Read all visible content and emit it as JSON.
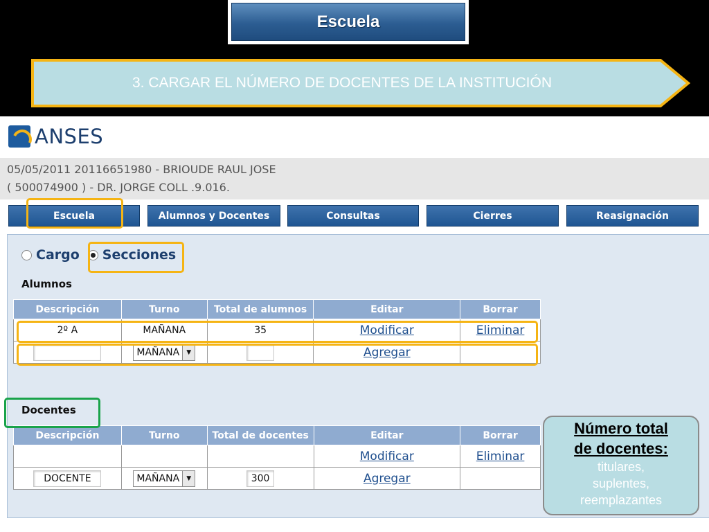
{
  "slide": {
    "title": "Escuela",
    "step": "3. CARGAR EL NÚMERO DE DOCENTES  DE LA INSTITUCIÓN"
  },
  "app": {
    "logo_text": "ANSES",
    "info_line1": "05/05/2011  20116651980 - BRIOUDE RAUL JOSE",
    "info_line2": "( 500074900 ) - DR. JORGE COLL .9.016."
  },
  "menu": [
    "Escuela",
    "Alumnos y Docentes",
    "Consultas",
    "Cierres",
    "Reasignación"
  ],
  "radio": {
    "cargo": "Cargo",
    "secciones": "Secciones",
    "selected": "Secciones"
  },
  "alumnos": {
    "label": "Alumnos",
    "headers": [
      "Descripción",
      "Turno",
      "Total de alumnos",
      "Editar",
      "Borrar"
    ],
    "row": {
      "descripcion": "2º A",
      "turno": "MAÑANA",
      "total": "35",
      "editar": "Modificar",
      "borrar": "Eliminar"
    },
    "new_row": {
      "descripcion": "",
      "turno": "MAÑANA",
      "total": "",
      "editar": "Agregar"
    }
  },
  "docentes": {
    "label": "Docentes",
    "headers": [
      "Descripción",
      "Turno",
      "Total de docentes",
      "Editar",
      "Borrar"
    ],
    "row": {
      "descripcion": "",
      "turno": "",
      "total": "",
      "editar": "Modificar",
      "borrar": "Eliminar"
    },
    "new_row": {
      "descripcion": "DOCENTE",
      "turno": "MAÑANA",
      "total": "300",
      "editar": "Agregar"
    }
  },
  "callout": {
    "title_line1": "Número total",
    "title_line2": "de docentes:",
    "body_line1": "titulares,",
    "body_line2": "suplentes,",
    "body_line3": "reemplazantes"
  },
  "colors": {
    "highlight": "#f5b414",
    "highlight_green": "#19a34a",
    "menu_blue": "#1f5592",
    "banner": "#b9dde3"
  }
}
